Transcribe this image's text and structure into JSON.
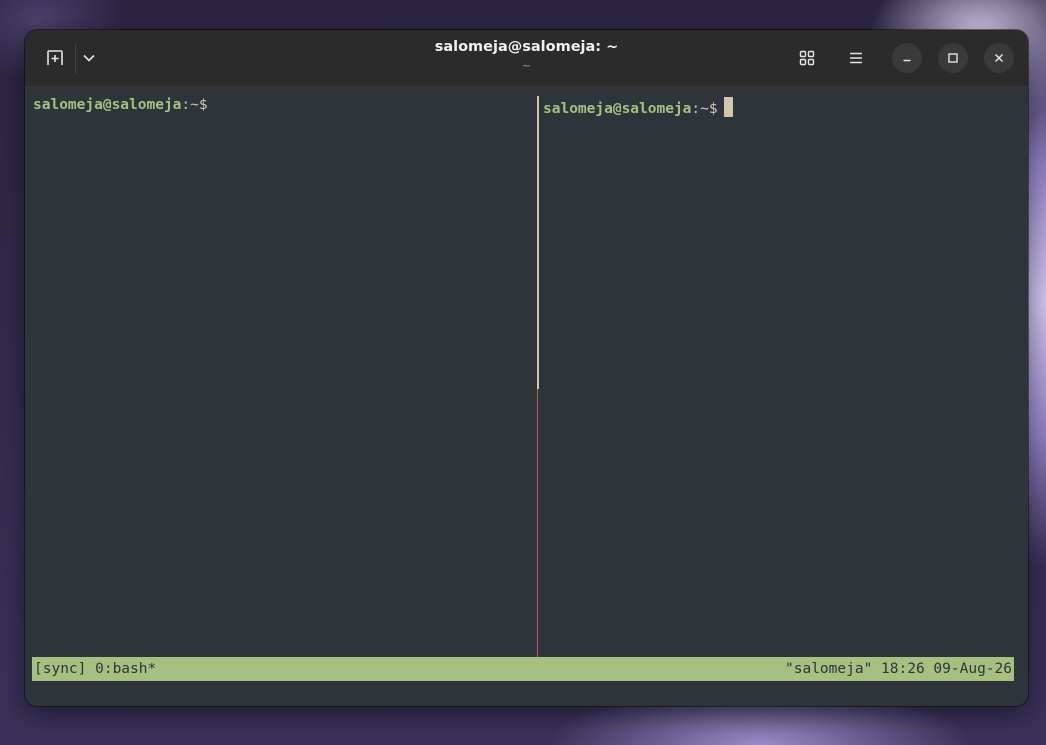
{
  "titlebar": {
    "title": "salomeja@salomeja: ~",
    "subtitle": "~",
    "icons": {
      "new_tab": "new-tab-icon",
      "dropdown": "chevron-down-icon",
      "view_tabs": "grid-icon",
      "menu": "hamburger-menu-icon",
      "minimize": "minimize-icon",
      "maximize": "maximize-icon",
      "close": "close-icon"
    }
  },
  "panes": [
    {
      "user_host": "salomeja@salomeja",
      "colon": ":",
      "path": "~",
      "prompt_symbol": "$"
    },
    {
      "user_host": "salomeja@salomeja",
      "colon": ":",
      "path": "~",
      "prompt_symbol": "$"
    }
  ],
  "statusbar": {
    "left": "[sync] 0:bash*",
    "right": "\"salomeja\" 18:26 09-Aug-26"
  },
  "colors": {
    "terminal_bg": "#2d353b",
    "prompt_user": "#a7c080",
    "foreground": "#d3c6aa",
    "statusbar_bg": "#a7c080",
    "divider_active": "#c0586e"
  }
}
